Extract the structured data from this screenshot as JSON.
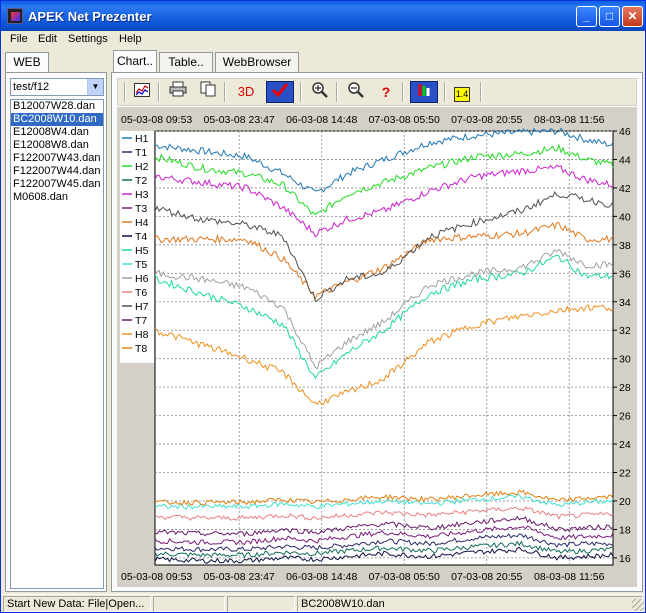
{
  "window": {
    "title": "APEK Net Prezenter"
  },
  "menu": [
    "File",
    "Edit",
    "Settings",
    "Help"
  ],
  "left": {
    "tab": "WEB",
    "combo_value": "test/f12",
    "files": [
      "B12007W28.dan",
      "BC2008W10.dan",
      "E12008W4.dan",
      "E12008W8.dan",
      "F122007W43.dan",
      "F122007W44.dan",
      "F122007W45.dan",
      "M0608.dan"
    ],
    "selected_index": 1
  },
  "tabs": [
    "Chart..",
    "Table..",
    "WebBrowser"
  ],
  "toolbar": {
    "three_d_label": "3D",
    "scale_label": "1.4"
  },
  "status": {
    "left": "Start New Data: File|Open...",
    "file": "BC2008W10.dan"
  },
  "colors": {
    "H1": "#1f77b4",
    "T1": "#2a2a6a",
    "H2": "#22dd22",
    "T2": "#146e5a",
    "H3": "#cc22cc",
    "T3": "#7a1a7a",
    "H4": "#e07820",
    "T4": "#111144",
    "H5": "#20d8a0",
    "T5": "#40e0d0",
    "H6": "#a0a0a0",
    "T6": "#e88080",
    "H7": "#505050",
    "T7": "#661a66",
    "H8": "#f09020",
    "T8": "#e08010"
  },
  "chart_data": {
    "type": "line",
    "x_ticks_top": [
      "05-03-08 09:53",
      "05-03-08 23:47",
      "06-03-08 14:48",
      "07-03-08 05:50",
      "07-03-08 20:55",
      "08-03-08 11:56"
    ],
    "x_ticks_bottom": [
      "05-03-08 09:53",
      "05-03-08 23:47",
      "06-03-08 14:48",
      "07-03-08 05:50",
      "07-03-08 20:55",
      "08-03-08 11:56"
    ],
    "y_ticks": [
      16,
      18,
      20,
      22,
      24,
      26,
      28,
      30,
      32,
      34,
      36,
      38,
      40,
      42,
      44,
      46
    ],
    "ylim": [
      15.5,
      46
    ],
    "x": [
      0,
      0.1,
      0.2,
      0.28,
      0.35,
      0.42,
      0.5,
      0.6,
      0.7,
      0.8,
      0.88,
      0.94,
      1.0
    ],
    "grid": true,
    "legend": "left",
    "series": [
      {
        "name": "H1",
        "values": [
          45.0,
          44.6,
          44.2,
          43.0,
          41.6,
          43.0,
          44.0,
          45.2,
          45.7,
          45.9,
          46.0,
          45.4,
          45.0
        ]
      },
      {
        "name": "T1",
        "values": [
          16.7,
          16.6,
          16.6,
          16.8,
          16.7,
          16.9,
          17.2,
          17.0,
          17.4,
          17.6,
          16.9,
          17.0,
          17.0
        ]
      },
      {
        "name": "H2",
        "values": [
          44.2,
          43.4,
          43.0,
          42.2,
          40.0,
          41.6,
          42.4,
          43.4,
          44.2,
          44.4,
          44.8,
          44.0,
          43.6
        ]
      },
      {
        "name": "T2",
        "values": [
          16.3,
          16.2,
          16.2,
          16.4,
          16.3,
          16.5,
          16.7,
          16.5,
          16.8,
          17.0,
          16.4,
          16.5,
          16.6
        ]
      },
      {
        "name": "H3",
        "values": [
          42.8,
          42.4,
          42.0,
          40.6,
          38.8,
          39.8,
          40.4,
          41.8,
          42.8,
          43.2,
          43.4,
          42.6,
          42.2
        ]
      },
      {
        "name": "T3",
        "values": [
          17.2,
          17.1,
          17.1,
          17.4,
          17.2,
          17.5,
          17.8,
          17.5,
          17.9,
          18.2,
          17.4,
          17.5,
          17.6
        ]
      },
      {
        "name": "H4",
        "values": [
          38.4,
          38.4,
          38.4,
          37.0,
          34.4,
          35.4,
          36.4,
          38.4,
          38.6,
          38.8,
          39.4,
          38.4,
          38.4
        ]
      },
      {
        "name": "T4",
        "values": [
          15.9,
          15.8,
          15.8,
          16.0,
          15.9,
          16.1,
          16.3,
          16.1,
          16.4,
          16.6,
          16.0,
          16.1,
          16.2
        ]
      },
      {
        "name": "H5",
        "values": [
          35.6,
          34.6,
          33.6,
          32.4,
          28.6,
          30.4,
          32.0,
          34.6,
          35.6,
          36.0,
          37.2,
          35.8,
          35.8
        ]
      },
      {
        "name": "T5",
        "values": [
          19.6,
          19.6,
          19.6,
          19.8,
          19.6,
          19.8,
          20.0,
          19.8,
          20.1,
          20.3,
          19.7,
          19.9,
          20.0
        ]
      },
      {
        "name": "H6",
        "values": [
          36.0,
          35.6,
          35.0,
          33.6,
          29.4,
          31.2,
          32.6,
          35.2,
          36.0,
          36.4,
          37.6,
          36.6,
          36.6
        ]
      },
      {
        "name": "T6",
        "values": [
          18.9,
          18.8,
          18.8,
          19.0,
          18.8,
          19.0,
          19.2,
          19.0,
          19.3,
          19.5,
          18.9,
          19.0,
          19.1
        ]
      },
      {
        "name": "H7",
        "values": [
          40.6,
          39.8,
          39.4,
          38.6,
          34.2,
          35.6,
          36.0,
          38.6,
          39.6,
          40.4,
          41.6,
          41.2,
          40.8
        ]
      },
      {
        "name": "T7",
        "values": [
          17.8,
          17.7,
          17.7,
          18.0,
          17.8,
          18.1,
          18.4,
          18.1,
          18.5,
          18.8,
          18.0,
          18.1,
          18.2
        ]
      },
      {
        "name": "H8",
        "values": [
          32.0,
          31.0,
          30.0,
          29.0,
          26.8,
          27.6,
          28.6,
          31.2,
          32.4,
          33.0,
          33.4,
          33.6,
          33.6
        ]
      },
      {
        "name": "T8",
        "values": [
          19.9,
          19.9,
          19.9,
          20.1,
          19.9,
          20.1,
          20.3,
          20.1,
          20.4,
          20.6,
          20.0,
          20.2,
          20.3
        ]
      }
    ]
  }
}
